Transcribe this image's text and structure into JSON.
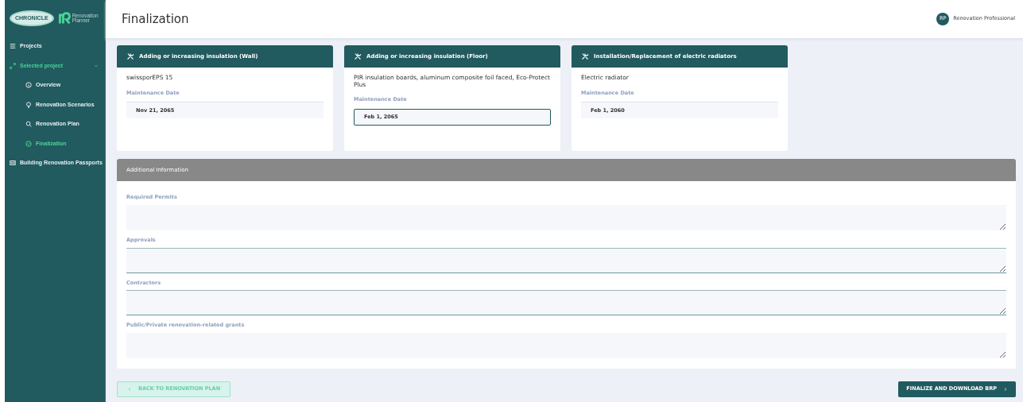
{
  "logo": {
    "brand": "CHRONICLE",
    "product": "Renovation Planner"
  },
  "sidebar": {
    "items": [
      {
        "label": "Projects",
        "selected": false
      },
      {
        "label": "Selected project",
        "selected": true,
        "expanded": true,
        "children": [
          {
            "label": "Overview",
            "selected": false
          },
          {
            "label": "Renovation Scenarios",
            "selected": false
          },
          {
            "label": "Renovation Plan",
            "selected": false
          },
          {
            "label": "Finalization",
            "selected": true
          }
        ]
      },
      {
        "label": "Building Renovation Passports",
        "selected": false
      }
    ]
  },
  "header": {
    "title": "Finalization",
    "user": {
      "initials": "RP",
      "name": "Renovation Professional"
    }
  },
  "measures": [
    {
      "title": "Adding or increasing insulation (Wall)",
      "product": "swissporEPS 15",
      "date_label": "Maintenance Date",
      "date": "Nov 21, 2065",
      "highlighted": false
    },
    {
      "title": "Adding or increasing insulation (Floor)",
      "product": "PIR insulation boards, aluminum composite foil faced, Eco-Protect Plus",
      "date_label": "Maintenance Date",
      "date": "Feb 1, 2065",
      "highlighted": true
    },
    {
      "title": "Installation/Replacement of electric radiators",
      "product": "Electric radiator",
      "date_label": "Maintenance Date",
      "date": "Feb 1, 2060",
      "highlighted": false
    }
  ],
  "additional": {
    "title": "Additional Information",
    "fields": [
      {
        "label": "Required Permits",
        "highlighted": false
      },
      {
        "label": "Approvals",
        "highlighted": true
      },
      {
        "label": "Contractors",
        "highlighted": true
      },
      {
        "label": "Public/Private renovation-related grants",
        "highlighted": false
      }
    ]
  },
  "buttons": [
    {
      "label": "BACK TO RENOVATION PLAN",
      "kind": "back"
    },
    {
      "label": "FINALIZE AND DOWNLOAD BRP",
      "kind": "next"
    }
  ]
}
